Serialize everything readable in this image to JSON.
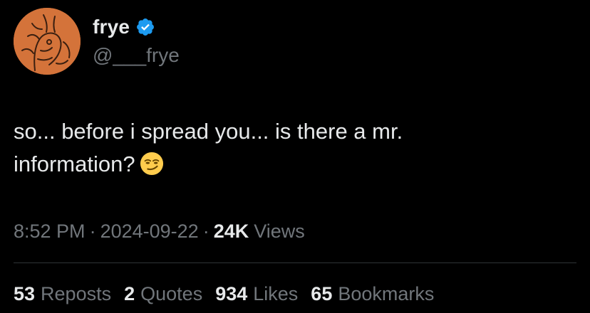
{
  "author": {
    "display_name": "frye",
    "handle": "@___frye",
    "verified": true
  },
  "tweet": {
    "text_line_1": "so... before i spread you... is there a mr.",
    "text_line_2": "information?",
    "emoji": "smirking-face"
  },
  "meta": {
    "time": "8:52 PM",
    "separator": "·",
    "date": "2024-09-22",
    "views_count": "24K",
    "views_label": "Views"
  },
  "stats": [
    {
      "count": "53",
      "label": "Reposts"
    },
    {
      "count": "2",
      "label": "Quotes"
    },
    {
      "count": "934",
      "label": "Likes"
    },
    {
      "count": "65",
      "label": "Bookmarks"
    }
  ],
  "colors": {
    "background": "#000000",
    "text_primary": "#e7e9ea",
    "text_secondary": "#71767b",
    "verified_badge": "#1d9bf0",
    "avatar_bg": "#d4733a",
    "divider": "#2f3336"
  }
}
